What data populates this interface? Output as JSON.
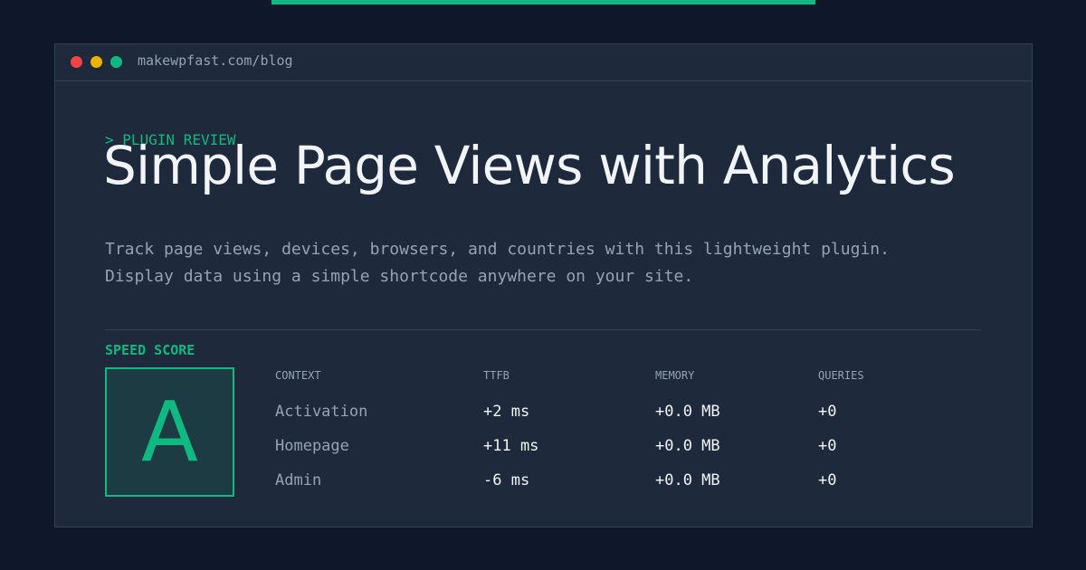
{
  "browser": {
    "url": "makewpfast.com/blog"
  },
  "post": {
    "kicker": "> PLUGIN REVIEW",
    "title": "Simple Page Views with Analytics",
    "description_lines": [
      "Track page views, devices, browsers, and countries with this lightweight plugin.",
      "Display data using a simple shortcode anywhere on your site."
    ]
  },
  "score": {
    "label": "SPEED SCORE",
    "grade": "A"
  },
  "metrics": {
    "columns": [
      "CONTEXT",
      "TTFB",
      "MEMORY",
      "QUERIES"
    ],
    "rows": [
      [
        "Activation",
        "+2 ms",
        "+0.0 MB",
        "+0"
      ],
      [
        "Homepage",
        "+11 ms",
        "+0.0 MB",
        "+0"
      ],
      [
        "Admin",
        "-6 ms",
        "+0.0 MB",
        "+0"
      ]
    ]
  },
  "colors": {
    "background": "#0f172a",
    "card": "#1e293b",
    "accent": "#10b981",
    "muted_text": "#94a3b8",
    "primary_text": "#f1f5f9"
  }
}
